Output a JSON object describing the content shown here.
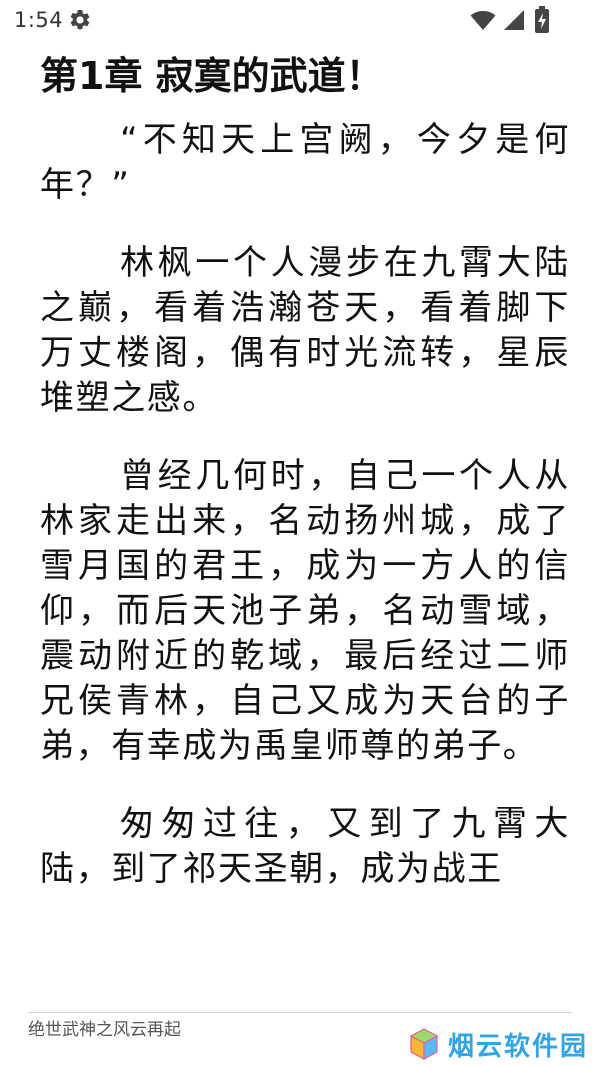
{
  "status_bar": {
    "time": "1:54",
    "icons": [
      "settings-gear-icon",
      "wifi-icon",
      "cell-signal-icon",
      "battery-charging-icon"
    ]
  },
  "reader": {
    "chapter_title": "第1章 寂寞的武道！",
    "paragraphs": [
      "“不知天上宫阙，今夕是何年？”",
      "林枫一个人漫步在九霄大陆之巅，看着浩瀚苍天，看着脚下万丈楼阁，偶有时光流转，星辰堆塑之感。",
      "曾经几何时，自己一个人从林家走出来，名动扬州城，成了雪月国的君王，成为一方人的信仰，而后天池子弟，名动雪域，震动附近的乾域，最后经过二师兄侯青林，自己又成为天台的子弟，有幸成为禹皇师尊的弟子。",
      "匆匆过往，又到了九霄大陆，到了祁天圣朝，成为战王"
    ]
  },
  "footer": {
    "book_title": "绝世武神之风云再起",
    "watermark_text": "烟云软件园"
  },
  "colors": {
    "background": "#ffffff",
    "text": "#111111",
    "watermark": "#2fa4e7",
    "status_icons": "#444444"
  }
}
